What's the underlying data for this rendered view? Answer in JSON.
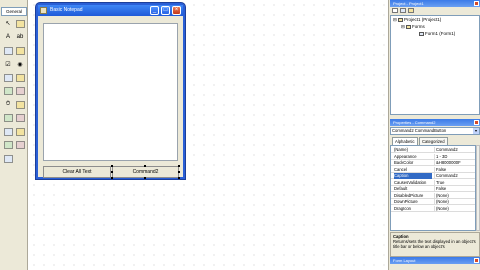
{
  "toolbox": {
    "title": "General",
    "tools": [
      {
        "name": "pointer-icon",
        "glyph": "↖"
      },
      {
        "name": "picturebox-icon",
        "glyph": ""
      },
      {
        "name": "label-icon",
        "glyph": "A"
      },
      {
        "name": "textbox-icon",
        "glyph": "ab"
      },
      {
        "name": "frame-icon",
        "glyph": ""
      },
      {
        "name": "commandbutton-icon",
        "glyph": ""
      },
      {
        "name": "checkbox-icon",
        "glyph": "☑"
      },
      {
        "name": "optionbutton-icon",
        "glyph": "◉"
      },
      {
        "name": "combobox-icon",
        "glyph": ""
      },
      {
        "name": "listbox-icon",
        "glyph": ""
      },
      {
        "name": "hscrollbar-icon",
        "glyph": ""
      },
      {
        "name": "vscrollbar-icon",
        "glyph": ""
      },
      {
        "name": "timer-icon",
        "glyph": "⏱"
      },
      {
        "name": "drivelistbox-icon",
        "glyph": ""
      },
      {
        "name": "dirlistbox-icon",
        "glyph": ""
      },
      {
        "name": "filelistbox-icon",
        "glyph": ""
      },
      {
        "name": "shape-icon",
        "glyph": ""
      },
      {
        "name": "line-icon",
        "glyph": ""
      },
      {
        "name": "image-icon",
        "glyph": ""
      },
      {
        "name": "data-icon",
        "glyph": ""
      },
      {
        "name": "ole-icon",
        "glyph": ""
      }
    ]
  },
  "form": {
    "title": "Basic Notepad",
    "buttons": {
      "clear": "Clear All Text",
      "command2": "Command2"
    }
  },
  "project": {
    "title": "Project - Project1",
    "tree": {
      "root": "Project1 (Project1)",
      "folder": "Forms",
      "item": "Form1 (Form1)"
    }
  },
  "properties": {
    "title": "Properties - Command2",
    "object": "Command2  CommandButton",
    "tabs": {
      "alpha": "Alphabetic",
      "cat": "Categorized"
    },
    "rows": [
      {
        "name": "(Name)",
        "value": "Command2"
      },
      {
        "name": "Appearance",
        "value": "1 - 3D"
      },
      {
        "name": "BackColor",
        "value": "&H8000000F"
      },
      {
        "name": "Cancel",
        "value": "False"
      },
      {
        "name": "Caption",
        "value": "Command2"
      },
      {
        "name": "CausesValidation",
        "value": "True"
      },
      {
        "name": "Default",
        "value": "False"
      },
      {
        "name": "DisabledPicture",
        "value": "(None)"
      },
      {
        "name": "DownPicture",
        "value": "(None)"
      },
      {
        "name": "DragIcon",
        "value": "(None)"
      }
    ],
    "selected_row": 4,
    "description": {
      "title": "Caption",
      "text": "Returns/sets the text displayed in an object's title bar or below an object's"
    }
  },
  "form_layout": {
    "title": "Form Layout"
  },
  "colors": {
    "titlebar": "#2a5fd6",
    "selection": "#316ac5",
    "chrome": "#ece9d8"
  }
}
